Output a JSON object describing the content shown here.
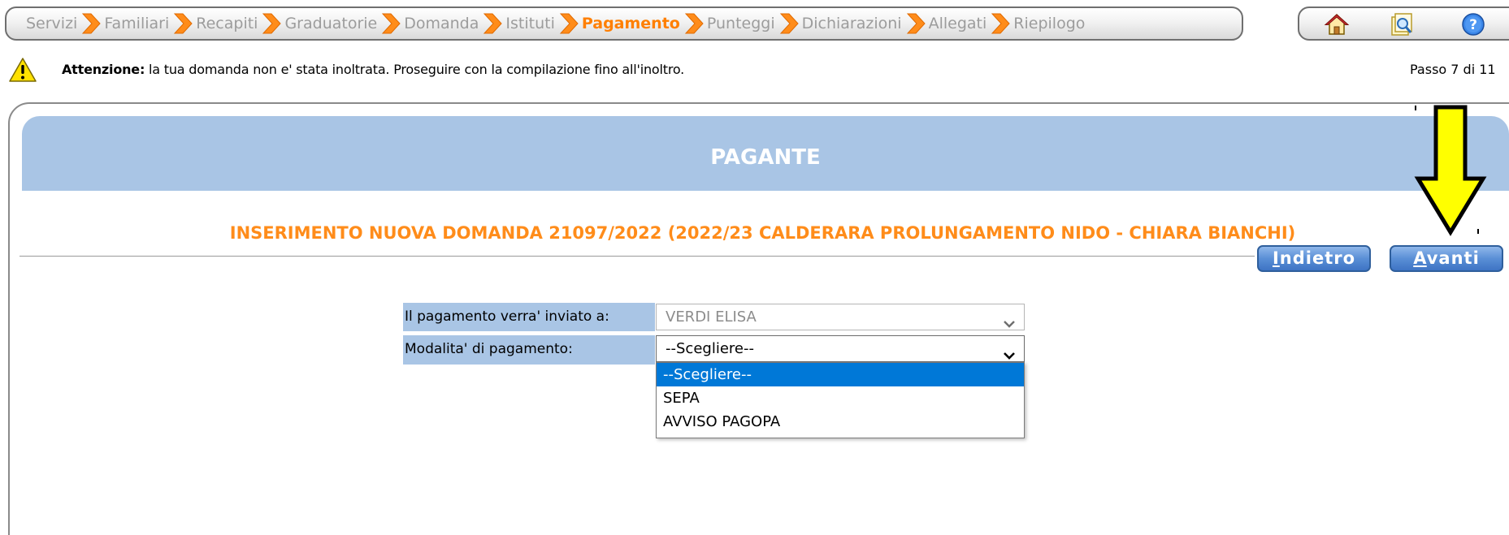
{
  "breadcrumb": {
    "items": [
      {
        "label": "Servizi",
        "active": false
      },
      {
        "label": "Familiari",
        "active": false
      },
      {
        "label": "Recapiti",
        "active": false
      },
      {
        "label": "Graduatorie",
        "active": false
      },
      {
        "label": "Domanda",
        "active": false
      },
      {
        "label": "Istituti",
        "active": false
      },
      {
        "label": "Pagamento",
        "active": true
      },
      {
        "label": "Punteggi",
        "active": false
      },
      {
        "label": "Dichiarazioni",
        "active": false
      },
      {
        "label": "Allegati",
        "active": false
      },
      {
        "label": "Riepilogo",
        "active": false
      }
    ],
    "separator_icon": "orange-chevron-right-icon",
    "colors": {
      "inactive": "#9c9c9c",
      "active": "#ff7f00",
      "arrow": "#ff8c1a"
    }
  },
  "toolbar": {
    "icons": [
      "home-icon",
      "document-search-icon",
      "help-icon"
    ]
  },
  "notice": {
    "icon": "warning-icon",
    "strong": "Attenzione:",
    "text": " la tua domanda non e' stata inoltrata. Proseguire con la compilazione fino all'inoltro.",
    "step": "Passo 7 di 11"
  },
  "panel": {
    "title": "PAGANTE",
    "subtitle": "INSERIMENTO NUOVA DOMANDA 21097/2022 (2022/23 CALDERARA PROLUNGAMENTO NIDO - CHIARA BIANCHI)",
    "header_color": "#a9c5e5",
    "subtitle_color": "#ff8c1a"
  },
  "nav": {
    "back_label": "Indietro",
    "back_access_key": "I",
    "back_rest": "ndietro",
    "next_label": "Avanti",
    "next_access_key": "A",
    "next_rest": "vanti"
  },
  "form": {
    "payer_label": "Il pagamento verra' inviato a:",
    "payer_value": "VERDI ELISA",
    "method_label": "Modalita' di pagamento:",
    "method_value": "--Scegliere--",
    "method_options": [
      "--Scegliere--",
      "SEPA",
      "AVVISO PAGOPA"
    ],
    "method_highlighted_index": 0
  },
  "annotation": {
    "icon": "yellow-down-arrow-icon",
    "color": "#ffff00"
  }
}
